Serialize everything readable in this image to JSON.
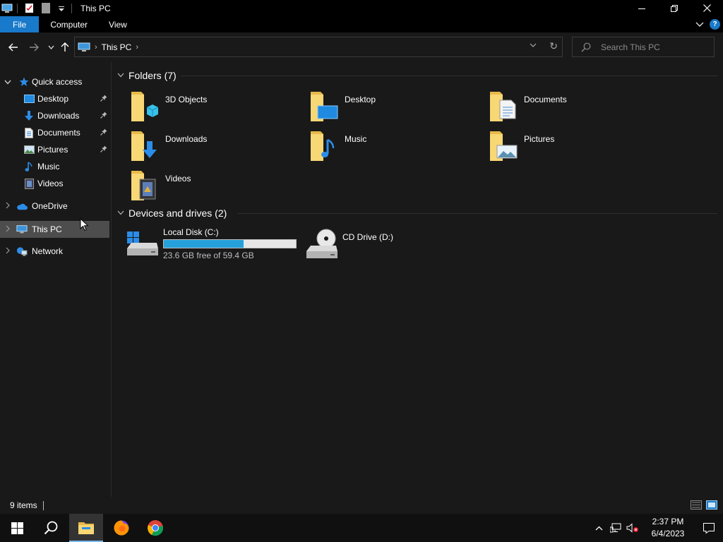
{
  "window": {
    "title": "This PC",
    "controls": {
      "minimize": "—",
      "maximize": "❐",
      "close": "✕"
    }
  },
  "ribbon": {
    "tabs": [
      "File",
      "Computer",
      "View"
    ]
  },
  "address": {
    "path": "This PC",
    "search_placeholder": "Search This PC"
  },
  "nav_pane": {
    "quick_access": "Quick access",
    "quick_items": [
      {
        "label": "Desktop",
        "icon": "desktop-icon",
        "pinned": true
      },
      {
        "label": "Downloads",
        "icon": "downloads-icon",
        "pinned": true
      },
      {
        "label": "Documents",
        "icon": "documents-icon",
        "pinned": true
      },
      {
        "label": "Pictures",
        "icon": "pictures-icon",
        "pinned": true
      },
      {
        "label": "Music",
        "icon": "music-icon",
        "pinned": false
      },
      {
        "label": "Videos",
        "icon": "videos-icon",
        "pinned": false
      }
    ],
    "onedrive": "OneDrive",
    "this_pc": "This PC",
    "network": "Network"
  },
  "content": {
    "folders_header": "Folders (7)",
    "folders": [
      {
        "label": "3D Objects",
        "icon": "3d-objects-folder-icon"
      },
      {
        "label": "Desktop",
        "icon": "desktop-folder-icon"
      },
      {
        "label": "Documents",
        "icon": "documents-folder-icon"
      },
      {
        "label": "Downloads",
        "icon": "downloads-folder-icon"
      },
      {
        "label": "Music",
        "icon": "music-folder-icon"
      },
      {
        "label": "Pictures",
        "icon": "pictures-folder-icon"
      },
      {
        "label": "Videos",
        "icon": "videos-folder-icon"
      }
    ],
    "drives_header": "Devices and drives (2)",
    "drives": [
      {
        "label": "Local Disk (C:)",
        "free_text": "23.6 GB free of 59.4 GB",
        "used_fraction": 0.603
      },
      {
        "label": "CD Drive (D:)"
      }
    ]
  },
  "status": {
    "items": "9 items"
  },
  "taskbar": {
    "time": "2:37 PM",
    "date": "6/4/2023"
  },
  "colors": {
    "accent": "#1979ca",
    "bar_fill": "#26a0da",
    "background": "#191919",
    "folder_yellow": "#f8d775"
  }
}
